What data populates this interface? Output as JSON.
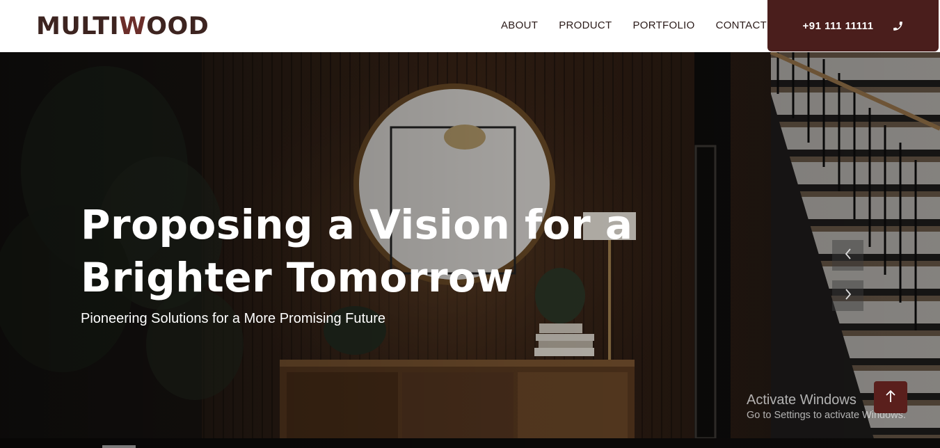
{
  "header": {
    "logo": {
      "part1": "MULTI",
      "part2": "W",
      "part3": "OOD"
    },
    "nav": [
      {
        "label": "ABOUT"
      },
      {
        "label": "PRODUCT"
      },
      {
        "label": "PORTFOLIO"
      },
      {
        "label": "CONTACT"
      }
    ],
    "phone": {
      "number": "+91 111 11111",
      "icon": "phone-icon"
    }
  },
  "hero": {
    "title": "Proposing a Vision for a Brighter Tomorrow",
    "subtitle": "Pioneering Solutions for a More Promising Future",
    "prev_icon": "chevron-left-icon",
    "next_icon": "chevron-right-icon"
  },
  "watermark": {
    "title": "Activate Windows",
    "subtitle": "Go to Settings to activate Windows."
  },
  "scroll_top": {
    "icon": "arrow-up-icon"
  },
  "colors": {
    "brand_dark": "#3d2420",
    "brand_accent": "#6b2e2a",
    "button_bg": "#4a1e1c",
    "to_top_bg": "#5a1f1c"
  }
}
